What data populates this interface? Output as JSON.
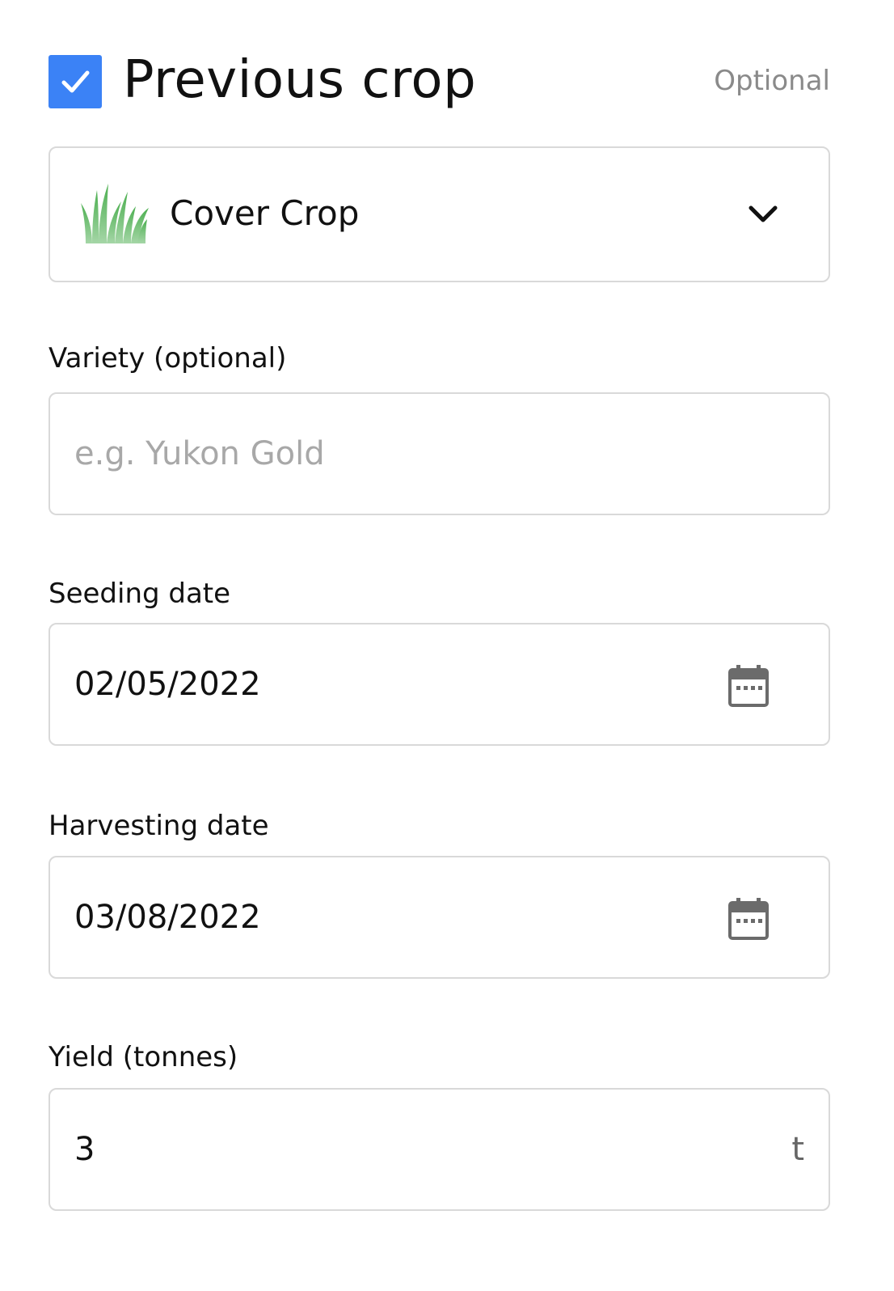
{
  "section": {
    "checked": true,
    "title": "Previous crop",
    "optional_label": "Optional"
  },
  "crop_select": {
    "icon": "grass-icon",
    "value": "Cover Crop"
  },
  "variety": {
    "label": "Variety (optional)",
    "placeholder": "e.g. Yukon Gold",
    "value": ""
  },
  "seeding": {
    "label": "Seeding date",
    "value": "02/05/2022",
    "icon": "calendar-icon"
  },
  "harvesting": {
    "label": "Harvesting date",
    "value": "03/08/2022",
    "icon": "calendar-icon"
  },
  "yield": {
    "label": "Yield (tonnes)",
    "value": "3",
    "unit": "t"
  },
  "colors": {
    "accent": "#3b82f6",
    "border": "#d9d9d9",
    "muted": "#8a8a8a"
  }
}
